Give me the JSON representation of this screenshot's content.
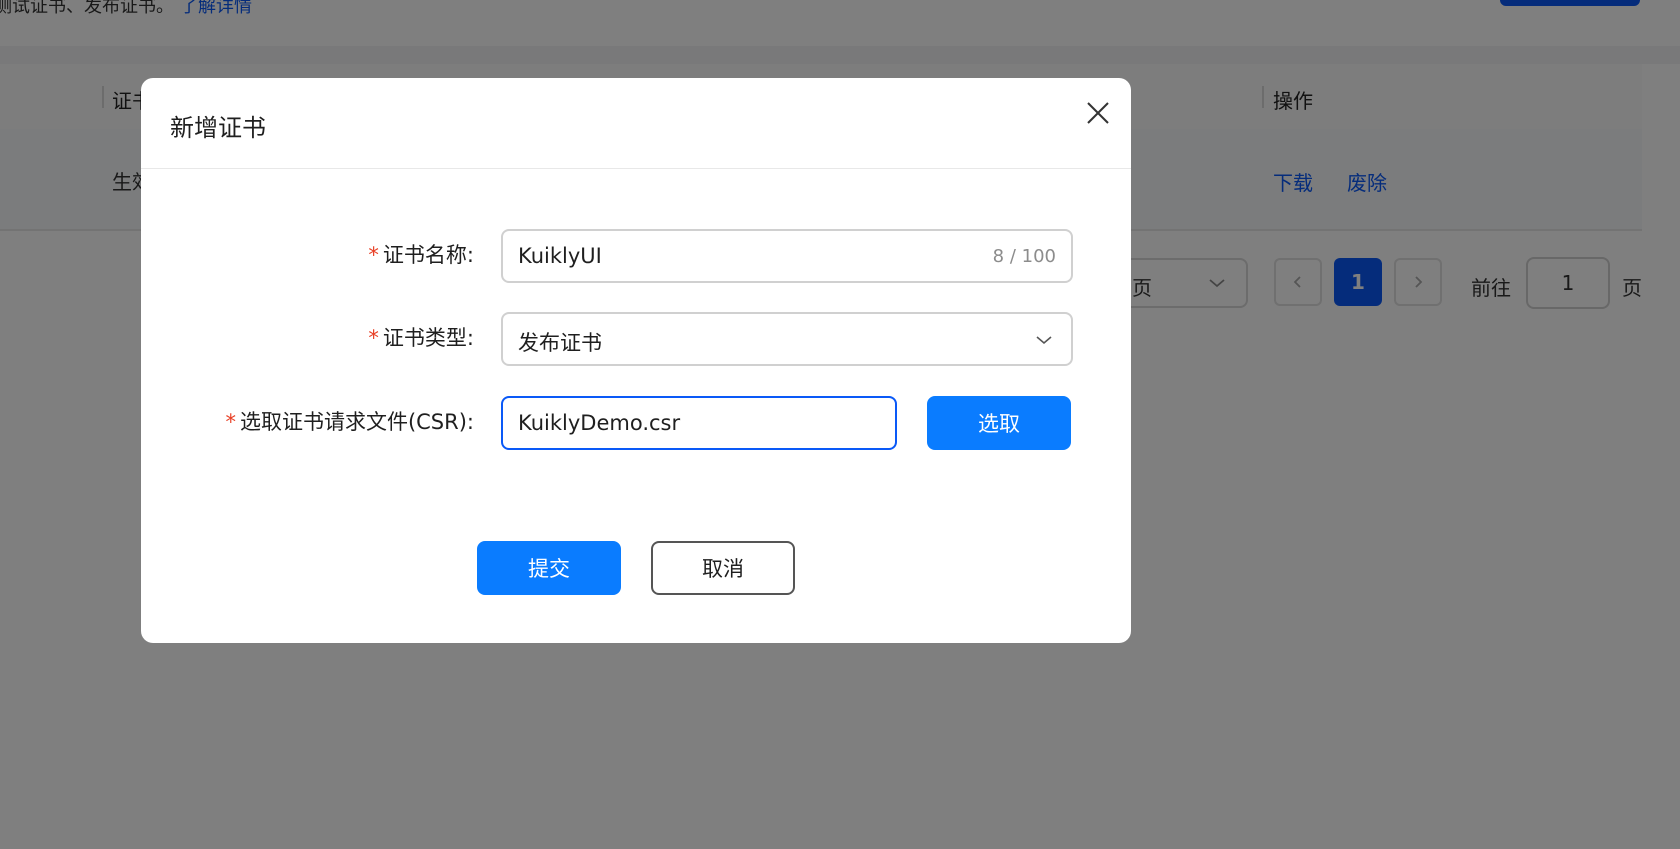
{
  "background": {
    "description": "测试证书、发布证书。",
    "learn_more": "了解详情",
    "table": {
      "header_col1": "证书",
      "header_actions": "操作",
      "row": {
        "status": "生效",
        "download": "下载",
        "revoke": "废除"
      }
    },
    "pagination": {
      "page_size_suffix": "页",
      "current_page": "1",
      "goto_label": "前往",
      "goto_value": "1",
      "goto_suffix": "页"
    }
  },
  "dialog": {
    "title": "新增证书",
    "fields": [
      {
        "label": "证书名称:",
        "value": "KuiklyUI",
        "counter": "8 / 100"
      },
      {
        "label": "证书类型:",
        "value": "发布证书"
      },
      {
        "label": "选取证书请求文件(CSR):",
        "value": "KuiklyDemo.csr"
      }
    ],
    "required_mark": "*",
    "choose_button": "选取",
    "submit_button": "提交",
    "cancel_button": "取消"
  },
  "colors": {
    "primary": "#0a7cff",
    "link": "#0a59f7",
    "required": "#e84026"
  }
}
